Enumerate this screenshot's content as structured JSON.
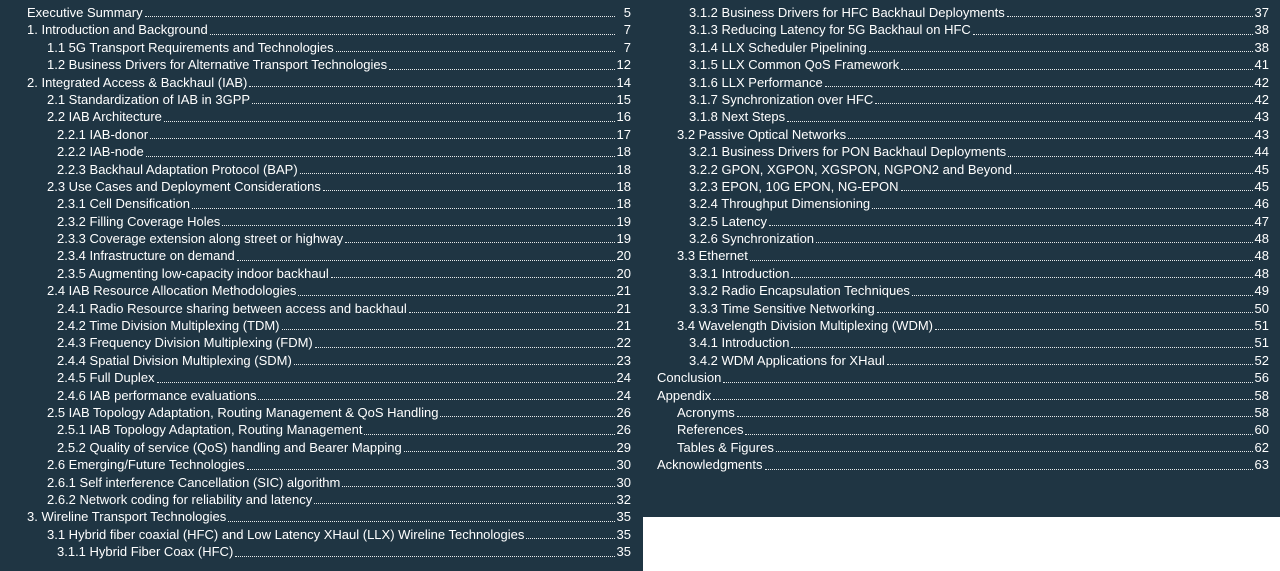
{
  "left": [
    {
      "title": "Executive Summary",
      "page": "5",
      "level": 0
    },
    {
      "title": "1. Introduction and Background",
      "page": "7",
      "level": 0
    },
    {
      "title": "1.1 5G Transport Requirements and Technologies",
      "page": "7",
      "level": 1
    },
    {
      "title": "1.2 Business Drivers for Alternative Transport Technologies",
      "page": "12",
      "level": 1
    },
    {
      "title": "2. Integrated Access & Backhaul (IAB)",
      "page": "14",
      "level": 0
    },
    {
      "title": "2.1 Standardization of IAB in 3GPP",
      "page": "15",
      "level": 1
    },
    {
      "title": "2.2 IAB Architecture",
      "page": "16",
      "level": 1
    },
    {
      "title": "2.2.1 IAB-donor",
      "page": "17",
      "level": 2
    },
    {
      "title": "2.2.2 IAB-node",
      "page": "18",
      "level": 2
    },
    {
      "title": "2.2.3 Backhaul Adaptation Protocol (BAP)",
      "page": "18",
      "level": 2
    },
    {
      "title": "2.3 Use Cases and Deployment Considerations",
      "page": "18",
      "level": 1
    },
    {
      "title": "2.3.1 Cell Densification",
      "page": "18",
      "level": 2
    },
    {
      "title": "2.3.2 Filling Coverage Holes",
      "page": "19",
      "level": 2
    },
    {
      "title": "2.3.3 Coverage extension along street or highway",
      "page": "19",
      "level": 2
    },
    {
      "title": "2.3.4 Infrastructure on demand",
      "page": "20",
      "level": 2
    },
    {
      "title": "2.3.5 Augmenting low-capacity indoor backhaul",
      "page": "20",
      "level": 2
    },
    {
      "title": "2.4 IAB Resource Allocation Methodologies",
      "page": "21",
      "level": 1
    },
    {
      "title": "2.4.1 Radio Resource sharing between access and backhaul",
      "page": "21",
      "level": 2
    },
    {
      "title": "2.4.2 Time Division Multiplexing (TDM)",
      "page": "21",
      "level": 2
    },
    {
      "title": "2.4.3 Frequency Division Multiplexing (FDM)",
      "page": "22",
      "level": 2
    },
    {
      "title": "2.4.4 Spatial Division Multiplexing (SDM)",
      "page": "23",
      "level": 2
    },
    {
      "title": "2.4.5 Full Duplex",
      "page": "24",
      "level": 2
    },
    {
      "title": "2.4.6 IAB performance evaluations",
      "page": "24",
      "level": 2
    },
    {
      "title": "2.5 IAB Topology Adaptation, Routing Management & QoS Handling",
      "page": "26",
      "level": 1
    },
    {
      "title": "2.5.1 IAB Topology Adaptation, Routing Management",
      "page": "26",
      "level": 2
    },
    {
      "title": "2.5.2 Quality of service (QoS) handling and Bearer Mapping",
      "page": "29",
      "level": 2
    },
    {
      "title": "2.6 Emerging/Future Technologies",
      "page": "30",
      "level": 1
    },
    {
      "title": "2.6.1 Self interference Cancellation (SIC) algorithm",
      "page": "30",
      "level": 1
    },
    {
      "title": "2.6.2 Network coding for reliability and latency",
      "page": "32",
      "level": 1
    },
    {
      "title": "3. Wireline Transport Technologies",
      "page": "35",
      "level": 0
    },
    {
      "title": "3.1 Hybrid fiber coaxial (HFC) and Low Latency XHaul (LLX) Wireline Technologies",
      "page": "35",
      "level": 1
    },
    {
      "title": "3.1.1 Hybrid Fiber Coax (HFC)",
      "page": "35",
      "level": 2
    }
  ],
  "right": [
    {
      "title": "3.1.2 Business Drivers for HFC Backhaul Deployments",
      "page": "37",
      "level": 2
    },
    {
      "title": "3.1.3 Reducing Latency for 5G Backhaul on HFC",
      "page": "38",
      "level": 2
    },
    {
      "title": "3.1.4 LLX Scheduler Pipelining",
      "page": "38",
      "level": 2
    },
    {
      "title": "3.1.5 LLX Common QoS Framework",
      "page": "41",
      "level": 2
    },
    {
      "title": "3.1.6 LLX Performance",
      "page": "42",
      "level": 2
    },
    {
      "title": "3.1.7 Synchronization over HFC",
      "page": "42",
      "level": 2
    },
    {
      "title": "3.1.8 Next Steps",
      "page": "43",
      "level": 2
    },
    {
      "title": "3.2 Passive Optical Networks",
      "page": "43",
      "level": 1
    },
    {
      "title": "3.2.1 Business Drivers for PON Backhaul Deployments",
      "page": "44",
      "level": 2
    },
    {
      "title": "3.2.2 GPON, XGPON, XGSPON, NGPON2 and Beyond",
      "page": "45",
      "level": 2
    },
    {
      "title": "3.2.3 EPON, 10G EPON, NG-EPON",
      "page": "45",
      "level": 2
    },
    {
      "title": "3.2.4 Throughput Dimensioning",
      "page": "46",
      "level": 2
    },
    {
      "title": "3.2.5 Latency",
      "page": "47",
      "level": 2
    },
    {
      "title": "3.2.6 Synchronization",
      "page": "48",
      "level": 2
    },
    {
      "title": "3.3 Ethernet",
      "page": "48",
      "level": 1
    },
    {
      "title": "3.3.1 Introduction",
      "page": "48",
      "level": 2
    },
    {
      "title": "3.3.2 Radio Encapsulation Techniques",
      "page": "49",
      "level": 2
    },
    {
      "title": "3.3.3 Time Sensitive Networking",
      "page": "50",
      "level": 2
    },
    {
      "title": "3.4 Wavelength Division Multiplexing (WDM)",
      "page": "51",
      "level": 1
    },
    {
      "title": "3.4.1 Introduction",
      "page": "51",
      "level": 2
    },
    {
      "title": "3.4.2 WDM Applications for XHaul",
      "page": "52",
      "level": 2
    },
    {
      "title": "Conclusion",
      "page": "56",
      "level": 0
    },
    {
      "title": "Appendix",
      "page": "58",
      "level": 0
    },
    {
      "title": "Acronyms",
      "page": "58",
      "level": 1
    },
    {
      "title": "References",
      "page": "60",
      "level": 1
    },
    {
      "title": "Tables & Figures",
      "page": "62",
      "level": 1
    },
    {
      "title": "Acknowledgments",
      "page": "63",
      "level": 0
    }
  ]
}
